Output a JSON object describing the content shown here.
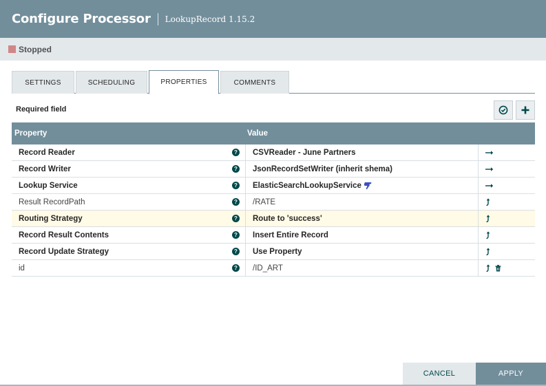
{
  "header": {
    "title": "Configure Processor",
    "subtitle": "LookupRecord 1.15.2"
  },
  "status": {
    "text": "Stopped",
    "color": "#d18686"
  },
  "tabs": [
    {
      "label": "SETTINGS",
      "active": false
    },
    {
      "label": "SCHEDULING",
      "active": false
    },
    {
      "label": "PROPERTIES",
      "active": true
    },
    {
      "label": "COMMENTS",
      "active": false
    }
  ],
  "properties_panel": {
    "required_label": "Required field",
    "toolbar_icons": [
      "verify-icon",
      "plus-icon"
    ]
  },
  "grid": {
    "headers": {
      "property": "Property",
      "value": "Value"
    },
    "rows": [
      {
        "property": "Record Reader",
        "value": "CSVReader - June Partners",
        "required": true,
        "action": "arrow-right-icon"
      },
      {
        "property": "Record Writer",
        "value": "JsonRecordSetWriter (inherit shema)",
        "required": true,
        "action": "arrow-right-icon"
      },
      {
        "property": "Lookup Service",
        "value": "ElasticSearchLookupService",
        "required": true,
        "action": "arrow-right-icon"
      },
      {
        "property": "Result RecordPath",
        "value": "/RATE",
        "required": false,
        "action": "expression-language-icon"
      },
      {
        "property": "Routing Strategy",
        "value": "Route to 'success'",
        "required": true,
        "action": "expression-language-icon"
      },
      {
        "property": "Record Result Contents",
        "value": "Insert Entire Record",
        "required": true,
        "action": "expression-language-icon"
      },
      {
        "property": "Record Update Strategy",
        "value": "Use Property",
        "required": true,
        "action": "expression-language-icon"
      },
      {
        "property": "id",
        "value": "/ID_ART",
        "required": false,
        "action": "expression-language-icon"
      }
    ]
  },
  "footer": {
    "cancel_label": "CANCEL",
    "apply_label": "APPLY"
  },
  "colors": {
    "header": "#728e9b",
    "accent": "#004849",
    "highlight_row": "#fffbe6"
  }
}
